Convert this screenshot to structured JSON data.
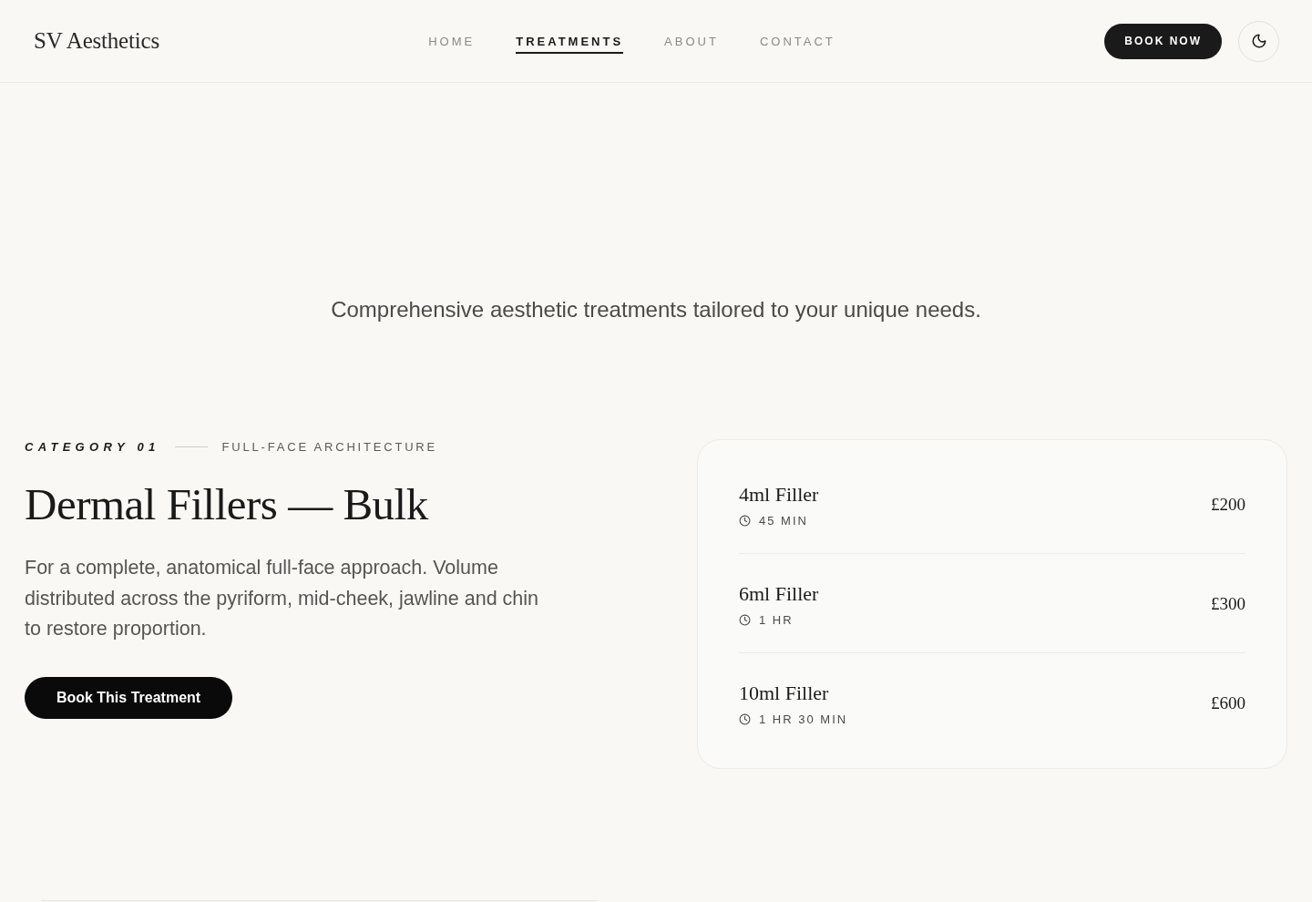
{
  "header": {
    "logo": "SV Aesthetics",
    "nav": [
      {
        "label": "HOME",
        "selected": false
      },
      {
        "label": "TREATMENTS",
        "selected": true
      },
      {
        "label": "ABOUT",
        "selected": false
      },
      {
        "label": "CONTACT",
        "selected": false
      }
    ],
    "cta": "BOOK NOW"
  },
  "tagline": "Comprehensive aesthetic treatments tailored to your unique needs.",
  "category": {
    "label": "CATEGORY 01",
    "subtitle": "FULL-FACE ARCHITECTURE",
    "title": "Dermal Fillers — Bulk",
    "description": "For a complete, anatomical full-face approach. Volume distributed across the pyriform, mid-cheek, jawline and chin to restore proportion.",
    "button": "Book This Treatment"
  },
  "options": [
    {
      "name": "4ml Filler",
      "duration": "45 MIN",
      "price": "£200"
    },
    {
      "name": "6ml Filler",
      "duration": "1 HR",
      "price": "£300"
    },
    {
      "name": "10ml Filler",
      "duration": "1 HR 30 MIN",
      "price": "£600"
    }
  ]
}
